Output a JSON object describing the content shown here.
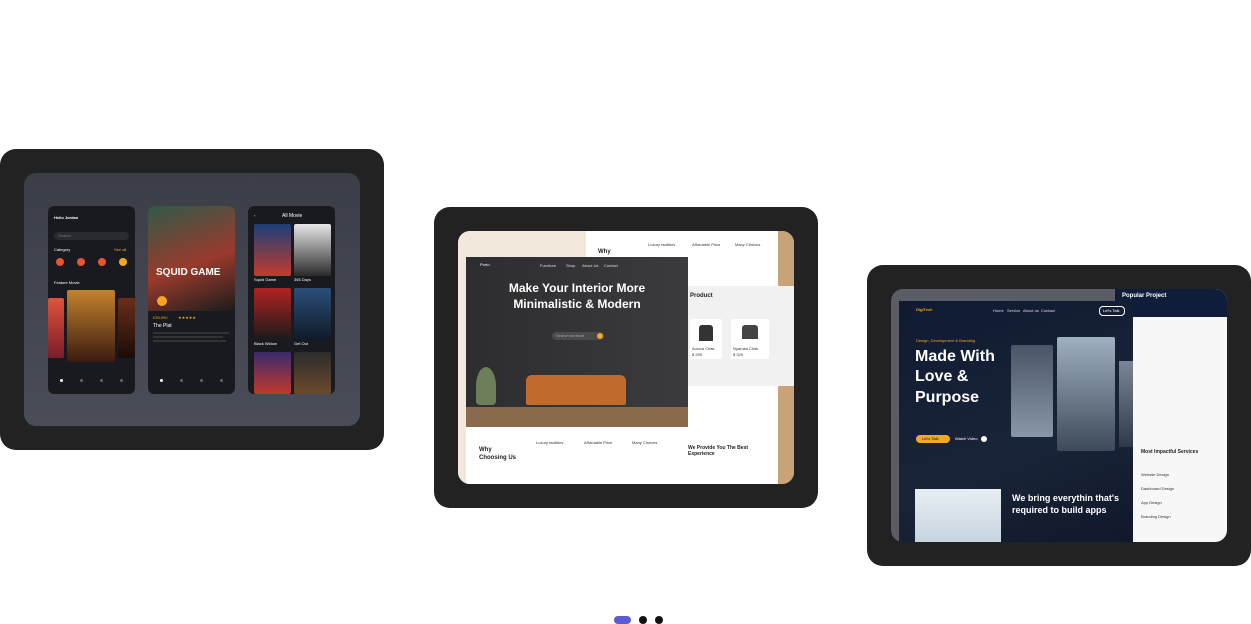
{
  "card1": {
    "greeting": "Hello Jordan",
    "search_placeholder": "Search",
    "category_label": "Category",
    "see_all": "See all",
    "feature_label": "Feature Movie",
    "categories": [
      "Romance",
      "Comedy",
      "Action",
      "Horror"
    ],
    "poster_title": "SQUID GAME",
    "price": "£39,990",
    "movie_title": "The Plat",
    "all_movie_header": "All Movie",
    "list_items": [
      "Squid Game",
      "365 Days",
      "Black Widow",
      "Get Out"
    ]
  },
  "card2": {
    "brand": "Porto",
    "nav": [
      "Furniture",
      "Shop",
      "About Us",
      "Contact"
    ],
    "hero_line1": "Make Your Interior More",
    "hero_line2": "Minimalistic & Modern",
    "search_placeholder": "Search furniture",
    "why_title": "Why\nChoosing Us",
    "why_title_short": "Why",
    "features": [
      "Luxury facilities",
      "Affordable Price",
      "Many Choices"
    ],
    "product_label": "Product",
    "product_items": [
      "Aurora Chair",
      "Nyaruka Chair"
    ],
    "product_prices": [
      "$ 299",
      "$ 329"
    ],
    "experience_title": "We Provide You The Best Experience"
  },
  "card3": {
    "brand": "DigiTech",
    "nav": [
      "Home",
      "Service",
      "About us",
      "Contact"
    ],
    "lets_talk": "Let's Talk",
    "tagline": "Design, Development & Branding",
    "hero_title_1": "Made With",
    "hero_title_2": "Love &",
    "hero_title_3": "Purpose",
    "cta_primary": "Let's Talk",
    "cta_secondary": "Watch Video",
    "popular_title": "Popular Project",
    "services_title": "Most Impactful Services",
    "services": [
      "Website Design",
      "Dashboard Design",
      "App Design",
      "Branding Design"
    ],
    "build_title_1": "We bring everythin that's",
    "build_title_2": "required to build apps"
  },
  "pagination": {
    "count": 3,
    "active": 0
  },
  "colors": {
    "card_bg": "#222222",
    "active_dot": "#5b5bd6",
    "dot": "#111111",
    "accent_orange": "#f5a623"
  }
}
